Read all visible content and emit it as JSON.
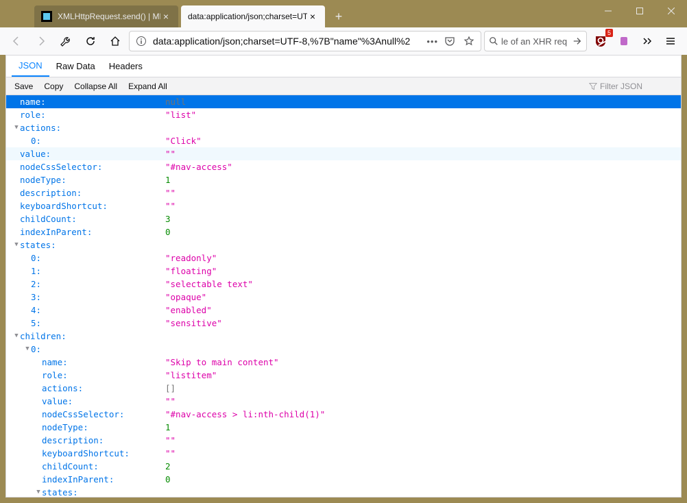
{
  "window": {
    "tabs": [
      {
        "label": "XMLHttpRequest.send() | MDN"
      },
      {
        "label": "data:application/json;charset=UTF"
      }
    ],
    "win_btn_badge": "5"
  },
  "navbar": {
    "url": "data:application/json;charset=UTF-8,%7B\"name\"%3Anull%2",
    "search_value": "le of an XHR req"
  },
  "json_viewer": {
    "tabs": {
      "json": "JSON",
      "raw": "Raw Data",
      "headers": "Headers"
    },
    "toolbar": {
      "save": "Save",
      "copy": "Copy",
      "collapse": "Collapse All",
      "expand": "Expand All",
      "filter_placeholder": "Filter JSON"
    }
  },
  "json_rows": [
    {
      "depth": 0,
      "twisty": "",
      "key": "name:",
      "val": "null",
      "vt": "null",
      "selected": true
    },
    {
      "depth": 0,
      "twisty": "",
      "key": "role:",
      "val": "\"list\"",
      "vt": "str"
    },
    {
      "depth": 0,
      "twisty": "▼",
      "key": "actions:",
      "val": "",
      "vt": ""
    },
    {
      "depth": 1,
      "twisty": "",
      "key": "0:",
      "val": "\"Click\"",
      "vt": "str"
    },
    {
      "depth": 0,
      "twisty": "",
      "key": "value:",
      "val": "\"\"",
      "vt": "str",
      "hover": true
    },
    {
      "depth": 0,
      "twisty": "",
      "key": "nodeCssSelector:",
      "val": "\"#nav-access\"",
      "vt": "str"
    },
    {
      "depth": 0,
      "twisty": "",
      "key": "nodeType:",
      "val": "1",
      "vt": "num"
    },
    {
      "depth": 0,
      "twisty": "",
      "key": "description:",
      "val": "\"\"",
      "vt": "str"
    },
    {
      "depth": 0,
      "twisty": "",
      "key": "keyboardShortcut:",
      "val": "\"\"",
      "vt": "str"
    },
    {
      "depth": 0,
      "twisty": "",
      "key": "childCount:",
      "val": "3",
      "vt": "num"
    },
    {
      "depth": 0,
      "twisty": "",
      "key": "indexInParent:",
      "val": "0",
      "vt": "num"
    },
    {
      "depth": 0,
      "twisty": "▼",
      "key": "states:",
      "val": "",
      "vt": ""
    },
    {
      "depth": 1,
      "twisty": "",
      "key": "0:",
      "val": "\"readonly\"",
      "vt": "str"
    },
    {
      "depth": 1,
      "twisty": "",
      "key": "1:",
      "val": "\"floating\"",
      "vt": "str"
    },
    {
      "depth": 1,
      "twisty": "",
      "key": "2:",
      "val": "\"selectable text\"",
      "vt": "str"
    },
    {
      "depth": 1,
      "twisty": "",
      "key": "3:",
      "val": "\"opaque\"",
      "vt": "str"
    },
    {
      "depth": 1,
      "twisty": "",
      "key": "4:",
      "val": "\"enabled\"",
      "vt": "str"
    },
    {
      "depth": 1,
      "twisty": "",
      "key": "5:",
      "val": "\"sensitive\"",
      "vt": "str"
    },
    {
      "depth": 0,
      "twisty": "▼",
      "key": "children:",
      "val": "",
      "vt": ""
    },
    {
      "depth": 1,
      "twisty": "▼",
      "key": "0:",
      "val": "",
      "vt": ""
    },
    {
      "depth": 2,
      "twisty": "",
      "key": "name:",
      "val": "\"Skip to main content\"",
      "vt": "str"
    },
    {
      "depth": 2,
      "twisty": "",
      "key": "role:",
      "val": "\"listitem\"",
      "vt": "str"
    },
    {
      "depth": 2,
      "twisty": "",
      "key": "actions:",
      "val": "[]",
      "vt": "arr"
    },
    {
      "depth": 2,
      "twisty": "",
      "key": "value:",
      "val": "\"\"",
      "vt": "str"
    },
    {
      "depth": 2,
      "twisty": "",
      "key": "nodeCssSelector:",
      "val": "\"#nav-access > li:nth-child(1)\"",
      "vt": "str"
    },
    {
      "depth": 2,
      "twisty": "",
      "key": "nodeType:",
      "val": "1",
      "vt": "num"
    },
    {
      "depth": 2,
      "twisty": "",
      "key": "description:",
      "val": "\"\"",
      "vt": "str"
    },
    {
      "depth": 2,
      "twisty": "",
      "key": "keyboardShortcut:",
      "val": "\"\"",
      "vt": "str"
    },
    {
      "depth": 2,
      "twisty": "",
      "key": "childCount:",
      "val": "2",
      "vt": "num"
    },
    {
      "depth": 2,
      "twisty": "",
      "key": "indexInParent:",
      "val": "0",
      "vt": "num"
    },
    {
      "depth": 2,
      "twisty": "▼",
      "key": "states:",
      "val": "",
      "vt": ""
    }
  ]
}
